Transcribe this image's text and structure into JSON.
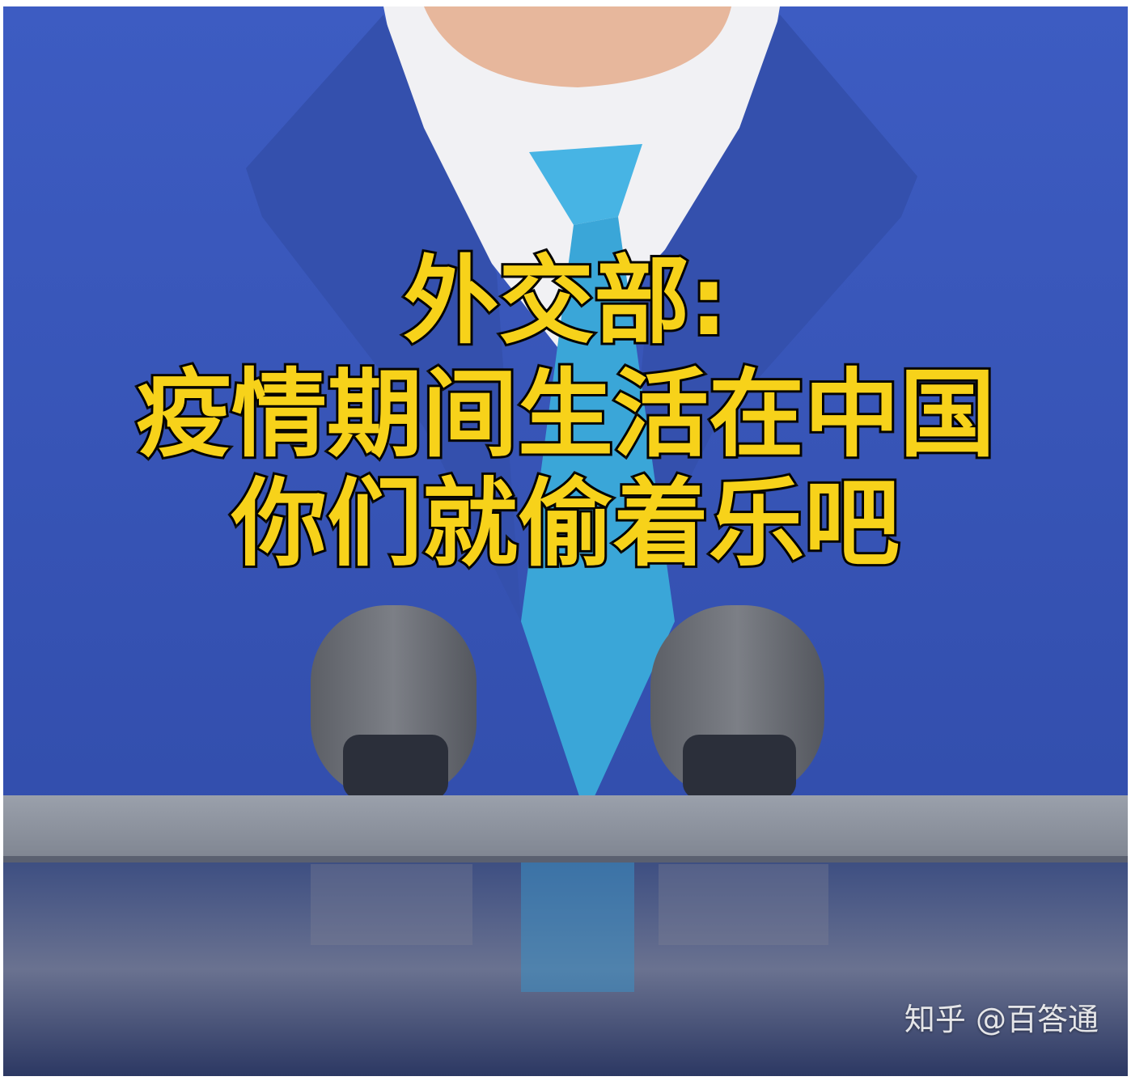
{
  "caption": {
    "line1": "外交部:",
    "line2": "疫情期间生活在中国",
    "line3": "你们就偷着乐吧"
  },
  "watermark": "知乎 @百答通",
  "colors": {
    "caption_fill": "#f7d21a",
    "caption_outline": "#111111",
    "background_blue": "#3a5cc4",
    "tie": "#3aa6d8"
  }
}
